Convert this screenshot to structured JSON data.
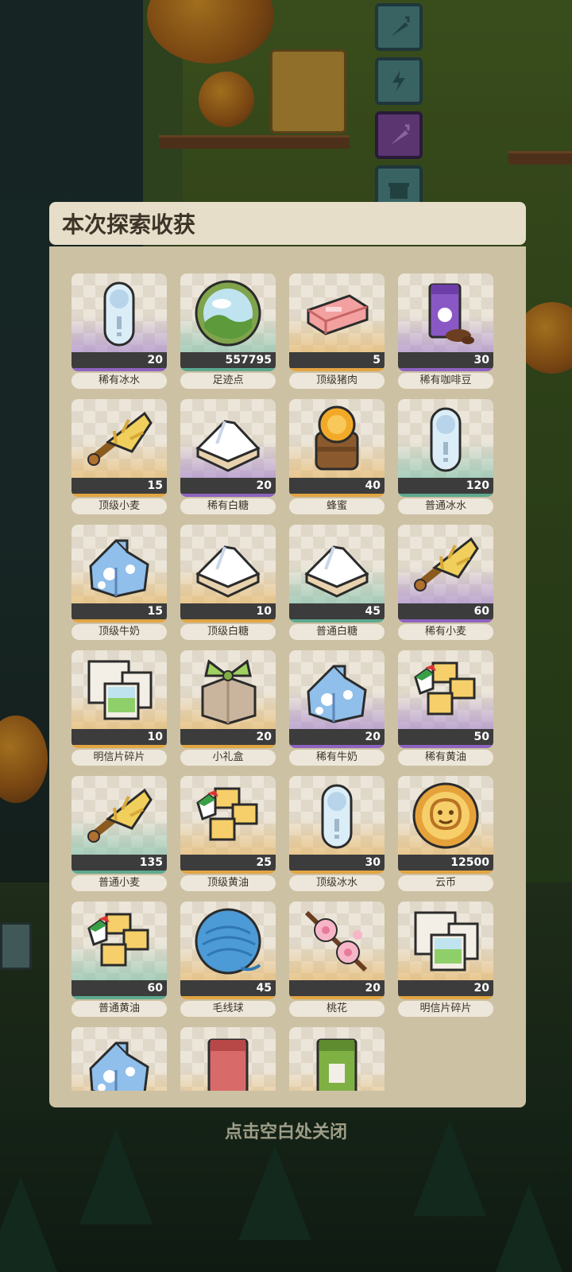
{
  "modal": {
    "title": "本次探索收获",
    "close_hint": "点击空白处关闭"
  },
  "rarity_colors": {
    "purple": "#8e63c0",
    "gold": "#e2a543",
    "teal": "#5ea98f"
  },
  "items": [
    {
      "name": "稀有冰水",
      "count": "20",
      "rarity": "purple",
      "icon": "ice-water-icon"
    },
    {
      "name": "足迹点",
      "count": "557795",
      "rarity": "teal",
      "icon": "footprint-orb-icon"
    },
    {
      "name": "顶级猪肉",
      "count": "5",
      "rarity": "gold",
      "icon": "pork-icon"
    },
    {
      "name": "稀有咖啡豆",
      "count": "30",
      "rarity": "purple",
      "icon": "coffee-bean-bag-icon"
    },
    {
      "name": "顶级小麦",
      "count": "15",
      "rarity": "gold",
      "icon": "wheat-icon"
    },
    {
      "name": "稀有白糖",
      "count": "20",
      "rarity": "purple",
      "icon": "sugar-icon"
    },
    {
      "name": "蜂蜜",
      "count": "40",
      "rarity": "gold",
      "icon": "honey-jar-icon"
    },
    {
      "name": "普通冰水",
      "count": "120",
      "rarity": "teal",
      "icon": "ice-water-icon"
    },
    {
      "name": "顶级牛奶",
      "count": "15",
      "rarity": "gold",
      "icon": "milk-carton-icon"
    },
    {
      "name": "顶级白糖",
      "count": "10",
      "rarity": "gold",
      "icon": "sugar-icon"
    },
    {
      "name": "普通白糖",
      "count": "45",
      "rarity": "teal",
      "icon": "sugar-icon"
    },
    {
      "name": "稀有小麦",
      "count": "60",
      "rarity": "purple",
      "icon": "wheat-icon"
    },
    {
      "name": "明信片碎片",
      "count": "10",
      "rarity": "gold",
      "icon": "postcard-icon"
    },
    {
      "name": "小礼盒",
      "count": "20",
      "rarity": "gold",
      "icon": "gift-box-icon"
    },
    {
      "name": "稀有牛奶",
      "count": "20",
      "rarity": "purple",
      "icon": "milk-carton-icon"
    },
    {
      "name": "稀有黄油",
      "count": "50",
      "rarity": "purple",
      "icon": "butter-icon"
    },
    {
      "name": "普通小麦",
      "count": "135",
      "rarity": "teal",
      "icon": "wheat-icon"
    },
    {
      "name": "顶级黄油",
      "count": "25",
      "rarity": "gold",
      "icon": "butter-icon"
    },
    {
      "name": "顶级冰水",
      "count": "30",
      "rarity": "gold",
      "icon": "ice-water-icon"
    },
    {
      "name": "云币",
      "count": "12500",
      "rarity": "gold",
      "icon": "cloud-coin-icon"
    },
    {
      "name": "普通黄油",
      "count": "60",
      "rarity": "teal",
      "icon": "butter-icon"
    },
    {
      "name": "毛线球",
      "count": "45",
      "rarity": "gold",
      "icon": "yarn-ball-icon"
    },
    {
      "name": "桃花",
      "count": "20",
      "rarity": "gold",
      "icon": "peach-blossom-icon"
    },
    {
      "name": "明信片碎片",
      "count": "20",
      "rarity": "gold",
      "icon": "postcard-icon"
    },
    {
      "name": "",
      "count": "",
      "rarity": "gold",
      "icon": "milk-carton-icon"
    },
    {
      "name": "",
      "count": "",
      "rarity": "gold",
      "icon": "red-bag-icon"
    },
    {
      "name": "",
      "count": "",
      "rarity": "gold",
      "icon": "green-bag-icon"
    }
  ]
}
